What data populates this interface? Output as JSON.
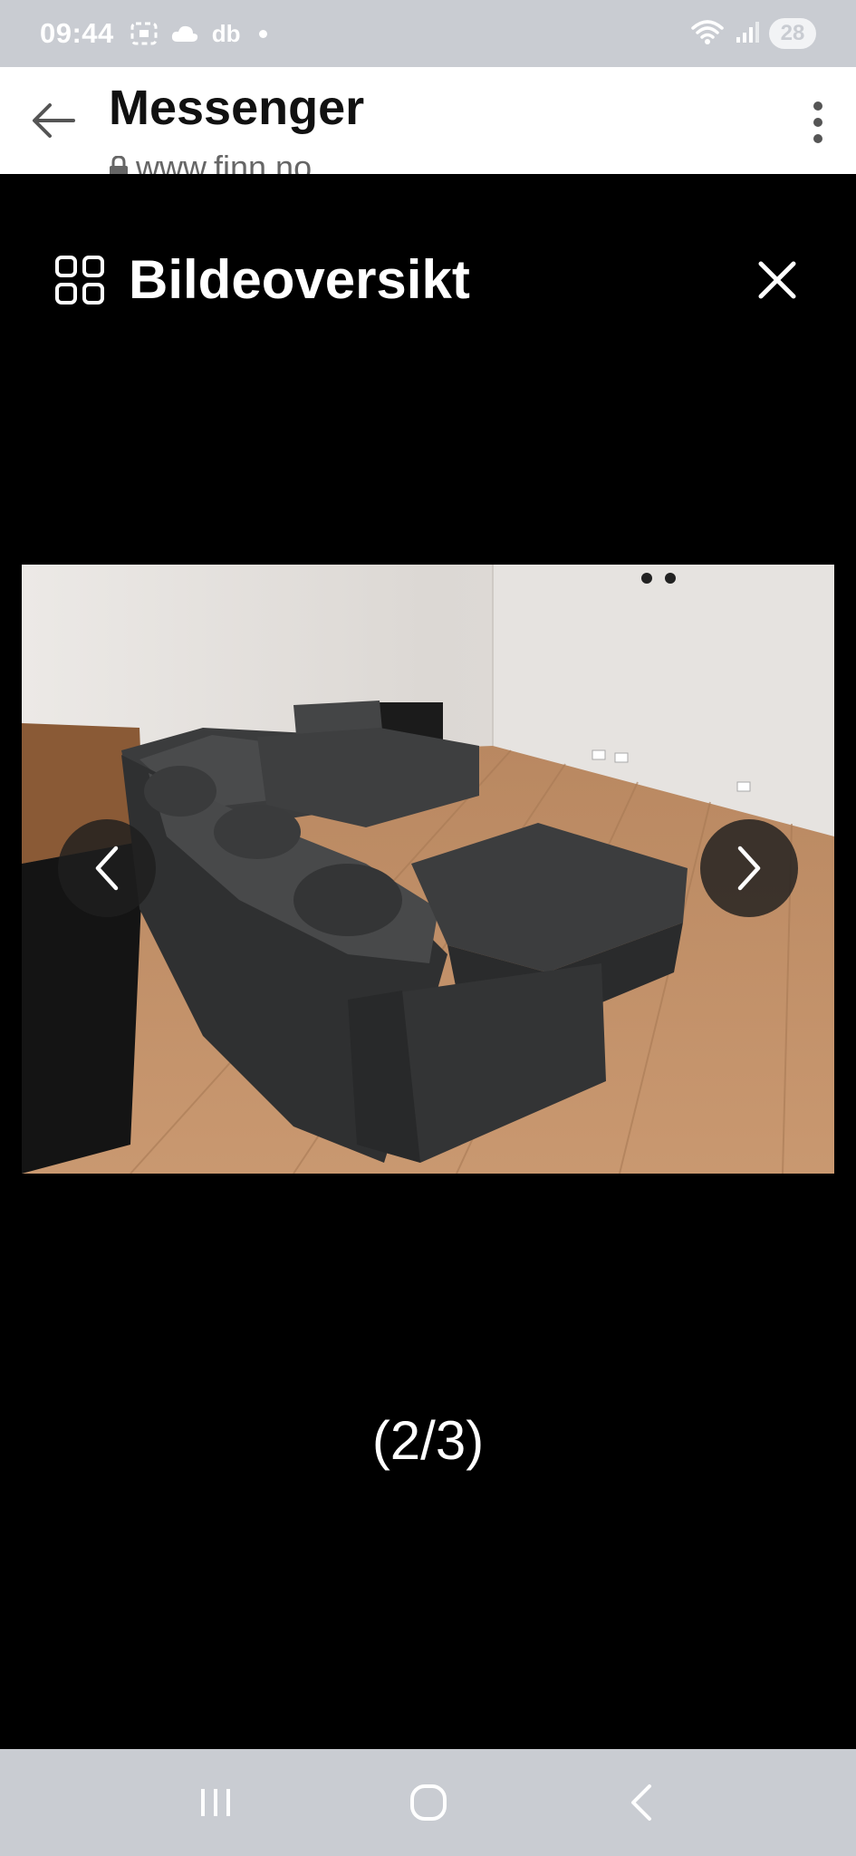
{
  "status_bar": {
    "time": "09:44",
    "carrier_text": "db",
    "battery_level": "28",
    "icons": [
      "screenshot-icon",
      "cloud-icon",
      "wifi-icon",
      "signal-icon"
    ]
  },
  "browser_header": {
    "title": "Messenger",
    "url": "www.finn.no",
    "icons": [
      "back-arrow-icon",
      "lock-icon",
      "more-vert-icon"
    ]
  },
  "viewer": {
    "title": "Bildeoversikt",
    "counter": "(2/3)",
    "icons": [
      "grid-icon",
      "close-icon",
      "chevron-left-icon",
      "chevron-right-icon"
    ],
    "current_index": 2,
    "total": 3
  },
  "system_nav": {
    "icons": [
      "recents-icon",
      "home-icon",
      "back-icon"
    ]
  },
  "colors": {
    "status_bar_bg": "#c9ccd2",
    "viewer_bg": "#000000",
    "nav_button_bg": "#1e1e1e"
  }
}
